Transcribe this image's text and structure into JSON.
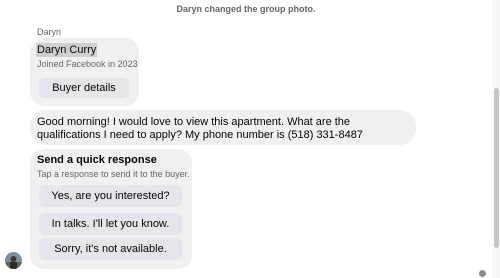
{
  "system_message": "Daryn changed the group photo.",
  "sender": {
    "name": "Daryn"
  },
  "profile_card": {
    "name": "Daryn Curry",
    "joined": "Joined Facebook in 2023",
    "button_label": "Buyer details"
  },
  "message": {
    "text": "Good morning! I would love to view this apartment. What are the qualifications I need to apply? My phone number is (518) 331-8487"
  },
  "quick_response": {
    "title": "Send a quick response",
    "subtitle": "Tap a response to send it to the buyer.",
    "options": [
      "Yes, are you interested?",
      "In talks. I'll let you know.",
      "Sorry, it's not available."
    ]
  },
  "colors": {
    "bubble": "#f0f0f0",
    "button": "#e4e6eb",
    "muted_text": "#65676b",
    "text": "#050505"
  }
}
